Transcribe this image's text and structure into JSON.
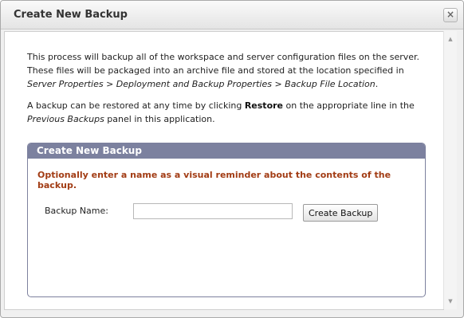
{
  "dialog": {
    "title": "Create New Backup",
    "close_label": "×"
  },
  "intro": {
    "part1": "This process will backup all of the workspace and server configuration files on the server. These files will be packaged into an archive file and stored at the location specified in ",
    "path": "Server Properties > Deployment and Backup Properties > Backup File Location",
    "part2": ".",
    "p2_part1": "A backup can be restored at any time by clicking ",
    "restore": "Restore",
    "p2_part2": " on the appropriate line in the ",
    "previous_backups": "Previous Backups",
    "p2_part3": " panel in this application."
  },
  "panel": {
    "header": "Create New Backup",
    "note": "Optionally enter a name as a visual reminder about the contents of the backup.",
    "name_label": "Backup Name:",
    "name_value": "",
    "button_label": "Create Backup"
  },
  "scrollbar": {
    "up_glyph": "▲",
    "down_glyph": "▼"
  }
}
